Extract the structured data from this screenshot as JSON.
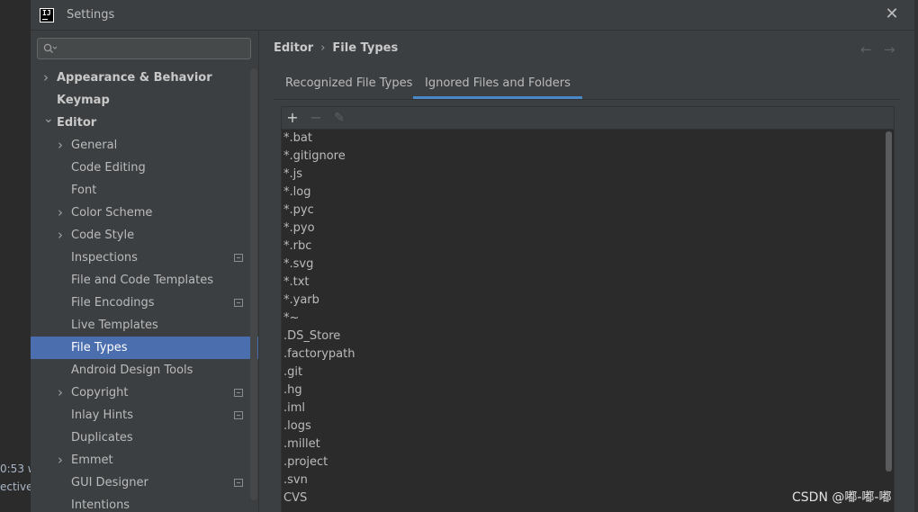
{
  "window": {
    "title": "Settings"
  },
  "background": {
    "status_time": "0:53 w",
    "status_text": "ective"
  },
  "search": {
    "placeholder": ""
  },
  "sidebar": {
    "items": [
      {
        "label": "Appearance & Behavior",
        "level": 0,
        "arrow": "right",
        "bold": true
      },
      {
        "label": "Keymap",
        "level": 0,
        "arrow": "none",
        "bold": true
      },
      {
        "label": "Editor",
        "level": 0,
        "arrow": "down",
        "bold": true
      },
      {
        "label": "General",
        "level": 1,
        "arrow": "right"
      },
      {
        "label": "Code Editing",
        "level": 1,
        "arrow": "none"
      },
      {
        "label": "Font",
        "level": 1,
        "arrow": "none"
      },
      {
        "label": "Color Scheme",
        "level": 1,
        "arrow": "right"
      },
      {
        "label": "Code Style",
        "level": 1,
        "arrow": "right"
      },
      {
        "label": "Inspections",
        "level": 1,
        "arrow": "none",
        "project_icon": true
      },
      {
        "label": "File and Code Templates",
        "level": 1,
        "arrow": "none"
      },
      {
        "label": "File Encodings",
        "level": 1,
        "arrow": "none",
        "project_icon": true
      },
      {
        "label": "Live Templates",
        "level": 1,
        "arrow": "none"
      },
      {
        "label": "File Types",
        "level": 1,
        "arrow": "none",
        "selected": true
      },
      {
        "label": "Android Design Tools",
        "level": 1,
        "arrow": "none"
      },
      {
        "label": "Copyright",
        "level": 1,
        "arrow": "right",
        "project_icon": true
      },
      {
        "label": "Inlay Hints",
        "level": 1,
        "arrow": "none",
        "project_icon": true
      },
      {
        "label": "Duplicates",
        "level": 1,
        "arrow": "none"
      },
      {
        "label": "Emmet",
        "level": 1,
        "arrow": "right"
      },
      {
        "label": "GUI Designer",
        "level": 1,
        "arrow": "none",
        "project_icon": true
      },
      {
        "label": "Intentions",
        "level": 1,
        "arrow": "none"
      }
    ]
  },
  "breadcrumb": {
    "parent": "Editor",
    "separator": "›",
    "current": "File Types"
  },
  "tabs": [
    {
      "label": "Recognized File Types",
      "active": false
    },
    {
      "label": "Ignored Files and Folders",
      "active": true
    }
  ],
  "toolbar": {
    "add": "+",
    "remove": "−",
    "edit": "✎"
  },
  "ignored": [
    "*.bat",
    "*.gitignore",
    "*.js",
    "*.log",
    "*.pyc",
    "*.pyo",
    "*.rbc",
    "*.svg",
    "*.txt",
    "*.yarb",
    "*~",
    ".DS_Store",
    ".factorypath",
    ".git",
    ".hg",
    ".iml",
    ".logs",
    ".millet",
    ".project",
    ".svn",
    "CVS"
  ],
  "watermark": "CSDN @嘟-嘟-嘟",
  "colors": {
    "selection": "#4b6eaf",
    "tab_underline": "#4a88c7",
    "background": "#3c3f41",
    "list_bg": "#2b2b2b"
  }
}
